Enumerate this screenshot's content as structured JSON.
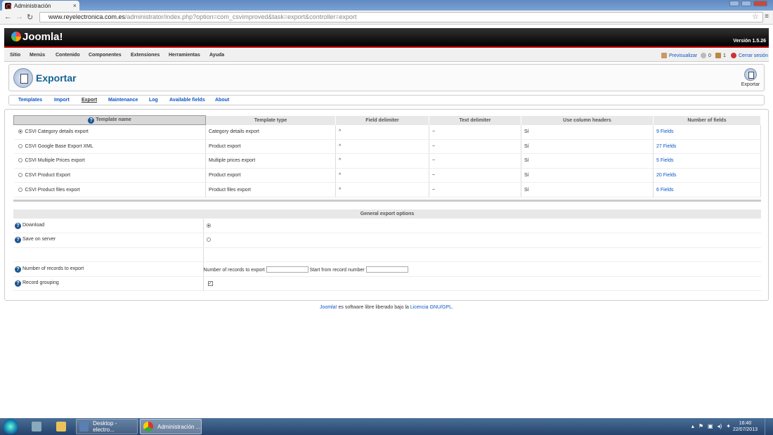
{
  "browser": {
    "tab_title": "Administración",
    "tab_close": "×",
    "url_host": "www.reyelectronica.com.es",
    "url_path": "/administrator/index.php?option=com_csvimproved&task=export&controller=export"
  },
  "header": {
    "logo_text": "Joomla!",
    "version": "Versión 1.5.26"
  },
  "menu": {
    "items": [
      "Sitio",
      "Menús",
      "Contenido",
      "Componentes",
      "Extensiones",
      "Herramientas",
      "Ayuda"
    ],
    "preview": "Previsualizar",
    "messages_count": "0",
    "users_count": "1",
    "logout": "Cerrar sesión"
  },
  "toolbar": {
    "page_title": "Exportar",
    "export_button": "Exportar"
  },
  "submenu": {
    "items": [
      "Templates",
      "Import",
      "Export",
      "Maintenance",
      "Log",
      "Available fields",
      "About"
    ],
    "active": "Export"
  },
  "templates_table": {
    "headers": [
      "Template name",
      "Template type",
      "Field delimiter",
      "Text delimiter",
      "Use column headers",
      "Number of fields"
    ],
    "rows": [
      {
        "name": "CSVI Category details export",
        "type": "Category details export",
        "field_delim": "^",
        "text_delim": "~",
        "headers": "Sí",
        "fields": "9 Fields",
        "selected": true
      },
      {
        "name": "CSVI Google Base Export XML",
        "type": "Product export",
        "field_delim": "^",
        "text_delim": "~",
        "headers": "Sí",
        "fields": "27 Fields",
        "selected": false
      },
      {
        "name": "CSVI Multiple Prices export",
        "type": "Multiple prices export",
        "field_delim": "^",
        "text_delim": "~",
        "headers": "Sí",
        "fields": "5 Fields",
        "selected": false
      },
      {
        "name": "CSVI Product Export",
        "type": "Product export",
        "field_delim": "^",
        "text_delim": "~",
        "headers": "Sí",
        "fields": "20 Fields",
        "selected": false
      },
      {
        "name": "CSVI Product files export",
        "type": "Product files export",
        "field_delim": "^",
        "text_delim": "~",
        "headers": "Sí",
        "fields": "6 Fields",
        "selected": false
      }
    ]
  },
  "export_options": {
    "title": "General export options",
    "download": "Download",
    "save_on_server": "Save on server",
    "records_label": "Number of records to export",
    "records_field": "Number of records to export",
    "start_field": "Start from record number",
    "record_grouping": "Record grouping",
    "check_mark": "✓"
  },
  "footer": {
    "joomla_link": "Joomla!",
    "text": " es software libre liberado bajo la ",
    "license": "Licencia GNU/GPL",
    "dot": "."
  },
  "taskbar": {
    "item1": "Desktop - electro...",
    "item2": "Administración ...",
    "time": "16:40",
    "date": "22/07/2013"
  }
}
